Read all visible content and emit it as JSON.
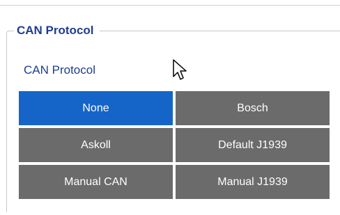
{
  "group": {
    "title": "CAN Protocol",
    "label": "CAN Protocol"
  },
  "options": [
    {
      "label": "None",
      "selected": true
    },
    {
      "label": "Bosch",
      "selected": false
    },
    {
      "label": "Askoll",
      "selected": false
    },
    {
      "label": "Default J1939",
      "selected": false
    },
    {
      "label": "Manual CAN",
      "selected": false
    },
    {
      "label": "Manual J1939",
      "selected": false
    }
  ],
  "colors": {
    "selected": "#1565c8",
    "unselected": "#6b6b6b",
    "title": "#1f3d8f"
  },
  "cursor_icon": "arrow-cursor-icon"
}
